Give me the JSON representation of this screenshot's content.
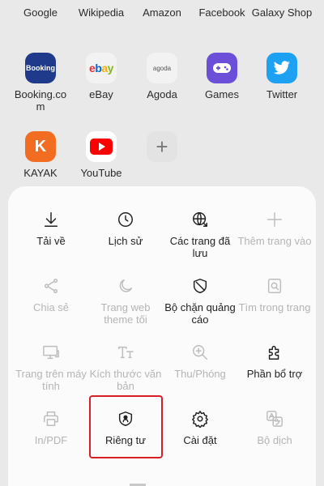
{
  "top_row": [
    "Google",
    "Wikipedia",
    "Amazon",
    "Facebook",
    "Galaxy Shop"
  ],
  "shortcuts": [
    {
      "label": "Booking.co\nm",
      "tile_text": "Booking",
      "color": "#1f3a8a",
      "icon": "booking-logo-icon"
    },
    {
      "label": "eBay",
      "tile_text": "ebay",
      "color": "#f2f2f2",
      "icon": "ebay-logo-icon"
    },
    {
      "label": "Agoda",
      "tile_text": "agoda",
      "color": "#f2f2f2",
      "icon": "agoda-logo-icon"
    },
    {
      "label": "Games",
      "tile_text": "",
      "color": "#6b4fd8",
      "icon": "gamepad-icon"
    },
    {
      "label": "Twitter",
      "tile_text": "",
      "color": "#1da1f2",
      "icon": "twitter-bird-icon"
    },
    {
      "label": "KAYAK",
      "tile_text": "K",
      "color": "#f26c22",
      "icon": "kayak-logo-icon"
    },
    {
      "label": "YouTube",
      "tile_text": "",
      "color": "#ffffff",
      "icon": "youtube-logo-icon"
    },
    {
      "label": "",
      "tile_text": "+",
      "color": "#e6e6e6",
      "icon": "add-shortcut-icon"
    }
  ],
  "menu": [
    {
      "label": "Tải về",
      "icon": "download-icon",
      "enabled": true
    },
    {
      "label": "Lịch sử",
      "icon": "clock-icon",
      "enabled": true
    },
    {
      "label": "Các trang đã lưu",
      "icon": "saved-pages-icon",
      "enabled": true
    },
    {
      "label": "Thêm trang vào",
      "icon": "plus-icon",
      "enabled": false
    },
    {
      "label": "Chia sẻ",
      "icon": "share-icon",
      "enabled": false
    },
    {
      "label": "Trang web theme tối",
      "icon": "moon-icon",
      "enabled": false
    },
    {
      "label": "Bộ chặn quảng cáo",
      "icon": "shield-icon",
      "enabled": true
    },
    {
      "label": "Tìm trong trang",
      "icon": "find-in-page-icon",
      "enabled": false
    },
    {
      "label": "Trang trên máy tính",
      "icon": "desktop-icon",
      "enabled": false
    },
    {
      "label": "Kích thước văn bản",
      "icon": "text-size-icon",
      "enabled": false
    },
    {
      "label": "Thu/Phóng",
      "icon": "zoom-icon",
      "enabled": false
    },
    {
      "label": "Phần bổ trợ",
      "icon": "puzzle-icon",
      "enabled": true
    },
    {
      "label": "In/PDF",
      "icon": "printer-icon",
      "enabled": false
    },
    {
      "label": "Riêng tư",
      "icon": "privacy-shield-icon",
      "enabled": true
    },
    {
      "label": "Cài đặt",
      "icon": "gear-icon",
      "enabled": true
    },
    {
      "label": "Bộ dịch",
      "icon": "translate-icon",
      "enabled": false
    }
  ],
  "accent": "#d61f26"
}
